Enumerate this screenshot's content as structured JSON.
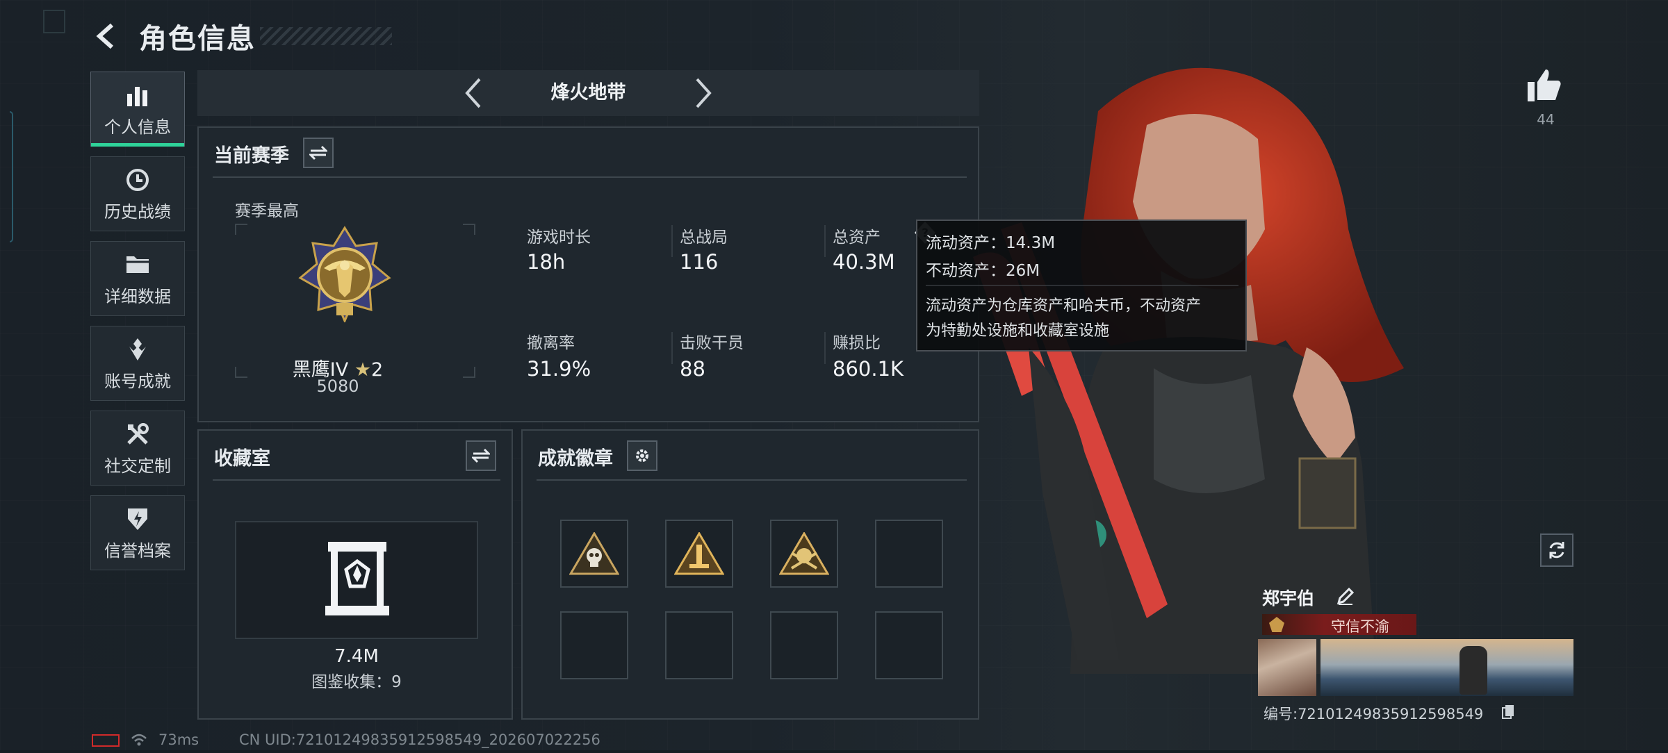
{
  "header": {
    "title": "角色信息"
  },
  "nav": {
    "items": [
      {
        "label": "个人信息",
        "icon": "bar-chart-icon",
        "active": true
      },
      {
        "label": "历史战绩",
        "icon": "clock-icon",
        "active": false
      },
      {
        "label": "详细数据",
        "icon": "folder-icon",
        "active": false
      },
      {
        "label": "账号成就",
        "icon": "trophy-icon",
        "active": false
      },
      {
        "label": "社交定制",
        "icon": "tools-icon",
        "active": false
      },
      {
        "label": "信誉档案",
        "icon": "shield-icon",
        "active": false
      }
    ]
  },
  "mode": {
    "title": "烽火地带"
  },
  "season": {
    "title": "当前赛季",
    "best_label": "赛季最高",
    "rank_name": "黑鹰IV",
    "rank_stars": "2",
    "rank_score": "5080",
    "stats": [
      {
        "label": "游戏时长",
        "value": "18h"
      },
      {
        "label": "总战局",
        "value": "116"
      },
      {
        "label": "总资产",
        "value": "40.3M"
      },
      {
        "label": "撤离率",
        "value": "31.9%"
      },
      {
        "label": "击败干员",
        "value": "88"
      },
      {
        "label": "赚损比",
        "value": "860.1K"
      }
    ]
  },
  "tooltip": {
    "liquid": "流动资产：14.3M",
    "fixed": "不动资产：26M",
    "desc1": "流动资产为仓库资产和哈夫币，不动资产",
    "desc2": "为特勤处设施和收藏室设施"
  },
  "collection": {
    "title": "收藏室",
    "value": "7.4M",
    "count": "图鉴收集：9"
  },
  "badges": {
    "title": "成就徽章",
    "slots": [
      "skull-badge-icon",
      "tower-badge-icon",
      "skull-triangle-badge-icon",
      "",
      "",
      "",
      "",
      ""
    ]
  },
  "profile": {
    "likes": "44",
    "name": "郑宇伯",
    "motto": "守信不渝",
    "uid_line": "编号:72101249835912598549"
  },
  "status": {
    "ping": "73ms",
    "uid": "CN UID:72101249835912598549_202607022256"
  },
  "colors": {
    "accent": "#2fd39a",
    "motto_bg": "#7a1c1c",
    "hair": "#b8321e",
    "gun": "#e0463e"
  }
}
